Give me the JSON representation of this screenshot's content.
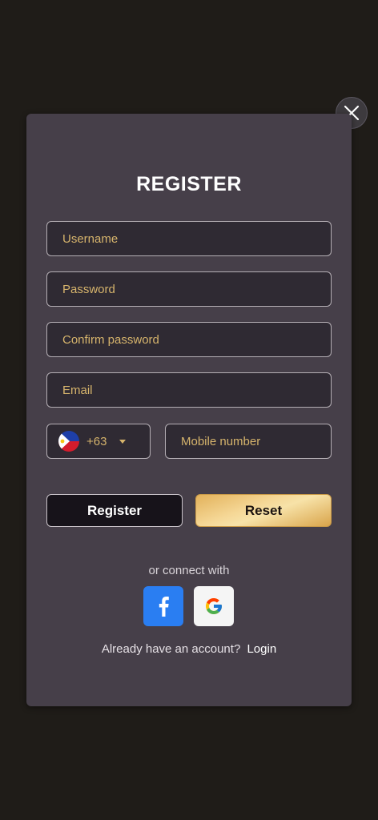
{
  "register": {
    "title": "REGISTER",
    "fields": {
      "username_placeholder": "Username",
      "password_placeholder": "Password",
      "confirm_placeholder": "Confirm password",
      "email_placeholder": "Email",
      "mobile_placeholder": "Mobile number"
    },
    "country": {
      "code": "+63",
      "flag": "philippines-flag-icon"
    },
    "buttons": {
      "register_label": "Register",
      "reset_label": "Reset"
    },
    "connect_label": "or connect with",
    "social": {
      "facebook_icon": "facebook-icon",
      "google_icon": "google-icon"
    },
    "footer": {
      "prompt": "Already have an account?",
      "login_label": "Login"
    }
  },
  "colors": {
    "background": "#1f1c18",
    "modal": "#463f49",
    "placeholder": "#d6b46c",
    "gold": "#f5d796",
    "facebook": "#2a7ef2"
  }
}
